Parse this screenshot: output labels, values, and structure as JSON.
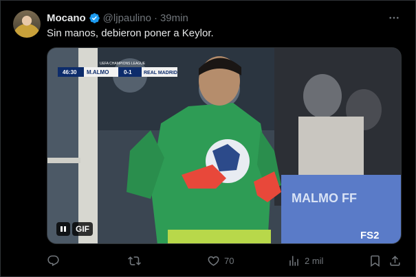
{
  "author": {
    "name": "Mocano",
    "handle": "@ljpaulino",
    "separator": "·",
    "time": "39min",
    "verified": true
  },
  "tweet_text": "Sin manos, debieron poner a Keylor.",
  "media": {
    "type": "gif",
    "gif_label": "GIF",
    "scorebug": {
      "clock": "46:30",
      "home": "M.ALMO",
      "score": "0-1",
      "away": "REAL MADRID",
      "competition": "UEFA CHAMPIONS LEAGUE"
    },
    "banner_text": "MALMO FF",
    "broadcast_logo": "FS2"
  },
  "actions": {
    "likes": "70",
    "views": "2 mil"
  },
  "colors": {
    "background": "#000000",
    "text": "#e7e9ea",
    "muted": "#71767b",
    "verified": "#1d9bf0"
  }
}
